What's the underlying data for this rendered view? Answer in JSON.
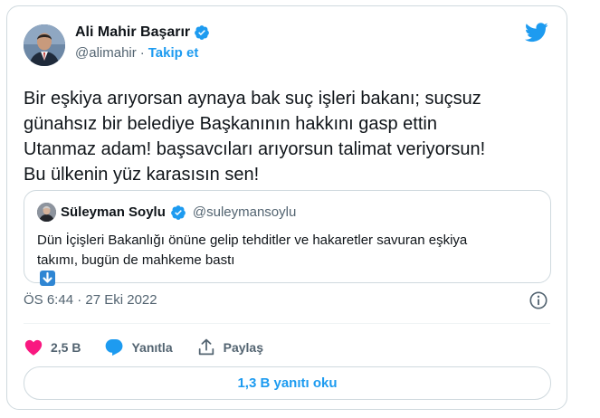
{
  "author": {
    "display_name": "Ali Mahir Başarır",
    "handle": "@alimahir",
    "separator": "·",
    "follow_label": "Takip et"
  },
  "tweet": {
    "text_lines": [
      "Bir eşkiya arıyorsan aynaya bak suç işleri bakanı; suçsuz",
      "günahsız bir belediye Başkanının hakkını gasp ettin",
      "Utanmaz adam! başsavcıları arıyorsun talimat veriyorsun!",
      "Bu ülkenin yüz karasısın sen!"
    ]
  },
  "quoted_tweet": {
    "display_name": "Süleyman Soylu",
    "handle": "@suleymansoylu",
    "text_lines": [
      "Dün İçişleri Bakanlığı önüne gelip tehditler ve hakaretler savuran eşkiya",
      "takımı, bugün de mahkeme bastı"
    ],
    "emoji": "down-arrow-emoji"
  },
  "meta": {
    "timestamp": "ÖS 6:44 · 27 Eki 2022"
  },
  "actions": {
    "like_count": "2,5 B",
    "reply_label": "Yanıtla",
    "share_label": "Paylaş"
  },
  "replies_button_label": "1,3 B yanıtı oku",
  "colors": {
    "brand_blue": "#1d9bf0",
    "like_pink": "#f91880",
    "secondary_text": "#536471",
    "border": "#cfd9de"
  },
  "icons": [
    "verified-badge-icon",
    "twitter-bird-icon",
    "heart-icon",
    "reply-bubble-icon",
    "share-icon",
    "info-icon"
  ]
}
